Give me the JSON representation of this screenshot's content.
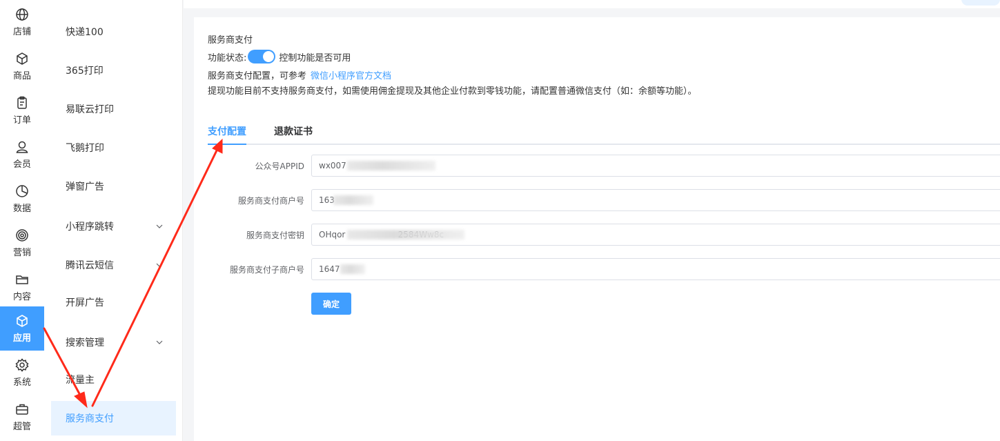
{
  "rail": {
    "items": [
      {
        "label": "店铺",
        "icon": "globe-icon"
      },
      {
        "label": "商品",
        "icon": "cube-icon"
      },
      {
        "label": "订单",
        "icon": "clipboard-icon"
      },
      {
        "label": "会员",
        "icon": "user-icon"
      },
      {
        "label": "数据",
        "icon": "pie-chart-icon"
      },
      {
        "label": "营销",
        "icon": "target-icon"
      },
      {
        "label": "内容",
        "icon": "folder-icon"
      },
      {
        "label": "应用",
        "icon": "app-cube-icon",
        "active": true
      },
      {
        "label": "系统",
        "icon": "gear-icon"
      },
      {
        "label": "超管",
        "icon": "briefcase-icon"
      }
    ]
  },
  "submenu": {
    "items": [
      {
        "label": "快递100"
      },
      {
        "label": "365打印"
      },
      {
        "label": "易联云打印"
      },
      {
        "label": "飞鹅打印"
      },
      {
        "label": "弹窗广告"
      },
      {
        "label": "小程序跳转",
        "expandable": true
      },
      {
        "label": "腾讯云短信",
        "expandable": true
      },
      {
        "label": "开屏广告"
      },
      {
        "label": "搜索管理",
        "expandable": true
      },
      {
        "label": "流量主"
      },
      {
        "label": "服务商支付",
        "active": true
      }
    ]
  },
  "page": {
    "title": "服务商支付",
    "status_label": "功能状态:",
    "status_desc": "控制功能是否可用",
    "ref_text": "服务商支付配置，可参考",
    "ref_link": "微信小程序官方文档",
    "note": "提现功能目前不支持服务商支付，如需使用佣金提现及其他企业付款到零钱功能，请配置普通微信支付（如：余额等功能）。"
  },
  "tabs": [
    {
      "label": "支付配置",
      "active": true
    },
    {
      "label": "退款证书"
    }
  ],
  "form": {
    "fields": [
      {
        "label": "公众号APPID",
        "value": "wx007"
      },
      {
        "label": "服务商支付商户号",
        "value": "163"
      },
      {
        "label": "服务商支付密钥",
        "value": "OHqor                    2584Ww8c"
      },
      {
        "label": "服务商支付子商户号",
        "value": "1647"
      }
    ],
    "submit_label": "确定"
  },
  "colors": {
    "primary": "#409eff",
    "active_bg": "#e8f3ff",
    "annotation": "#ff2a1a"
  }
}
